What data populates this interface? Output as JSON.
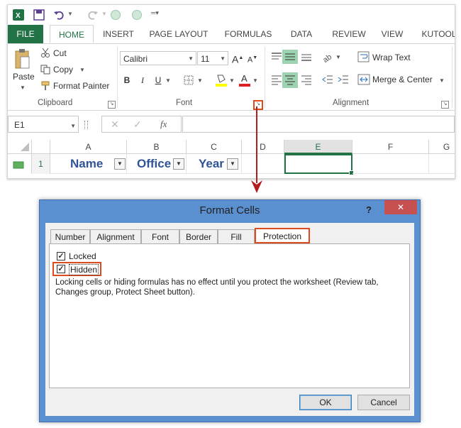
{
  "qat": {
    "excel_icon": "excel-logo-icon",
    "save_icon": "save-icon",
    "undo_icon": "undo-icon",
    "redo_icon": "redo-icon",
    "customize_icon": "customize-qat-icon"
  },
  "tabs": [
    {
      "label": "FILE"
    },
    {
      "label": "HOME"
    },
    {
      "label": "INSERT"
    },
    {
      "label": "PAGE LAYOUT"
    },
    {
      "label": "FORMULAS"
    },
    {
      "label": "DATA"
    },
    {
      "label": "REVIEW"
    },
    {
      "label": "VIEW"
    },
    {
      "label": "KUTOOL"
    }
  ],
  "clipboard": {
    "paste": "Paste",
    "cut": "Cut",
    "copy": "Copy",
    "format_painter": "Format Painter",
    "group_label": "Clipboard"
  },
  "font": {
    "name": "Calibri",
    "size": "11",
    "bold": "B",
    "italic": "I",
    "underline": "U",
    "grow": "A",
    "shrink": "A",
    "group_label": "Font"
  },
  "alignment": {
    "wrap_text": "Wrap Text",
    "merge_center": "Merge & Center",
    "group_label": "Alignment"
  },
  "formula_bar": {
    "name_box": "E1",
    "fx": "fx",
    "value": ""
  },
  "columns": [
    "A",
    "B",
    "C",
    "D",
    "E",
    "F",
    "G"
  ],
  "row_number": "1",
  "cells": {
    "A1": "Name",
    "B1": "Office",
    "C1": "Year"
  },
  "dialog": {
    "title": "Format Cells",
    "help": "?",
    "close": "✕",
    "tabs": [
      {
        "label": "Number"
      },
      {
        "label": "Alignment"
      },
      {
        "label": "Font"
      },
      {
        "label": "Border"
      },
      {
        "label": "Fill"
      },
      {
        "label": "Protection"
      }
    ],
    "locked_label": "Locked",
    "hidden_label": "Hidden",
    "locked_checked": true,
    "hidden_checked": true,
    "note": "Locking cells or hiding formulas has no effect until you protect the worksheet (Review tab, Changes group, Protect Sheet button).",
    "ok": "OK",
    "cancel": "Cancel"
  },
  "colors": {
    "excel_green": "#217346",
    "highlight_red": "#e04a1f",
    "header_blue": "#2f5496",
    "dialog_title_blue": "#5a8fd0",
    "close_red": "#c75050"
  }
}
